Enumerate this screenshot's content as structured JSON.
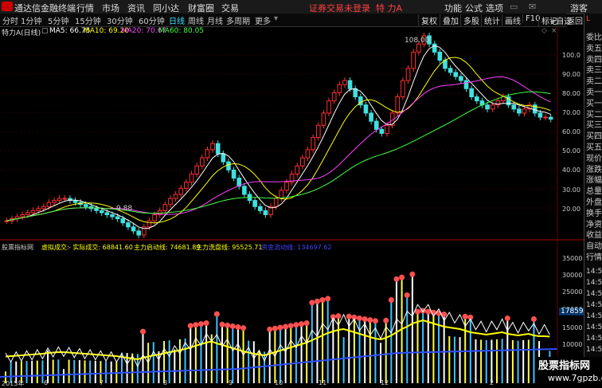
{
  "menu": {
    "app_title": "通达信金融终端",
    "items": [
      "行情",
      "市场",
      "资讯",
      "同小达",
      "财富圈",
      "交易"
    ],
    "notice": "证券交易未登录",
    "stock": "特 力A",
    "right_items": [
      "功能",
      "公式",
      "选项"
    ],
    "guest": "游客"
  },
  "toolbar": {
    "periods": [
      "分时",
      "1分钟",
      "5分钟",
      "15分钟",
      "30分钟",
      "60分钟",
      "日线",
      "周线",
      "月线",
      "多周期",
      "更多"
    ],
    "active": "日线",
    "right": [
      "复权",
      "叠加",
      "多股",
      "统计",
      "画线",
      "F10",
      "标记",
      "+自选",
      "返回"
    ]
  },
  "chart_header": {
    "title": "特力A(日线)",
    "ma5": "MA5: 66.75",
    "ma10": "MA10: 69.20",
    "ma20": "MA20: 70.67",
    "ma60": "MA60: 80.05"
  },
  "indicator_header": {
    "name": "股票指标网",
    "l1": "虚拟成交: ",
    "l2": "- 实际成交: 68841.60",
    "l3": "主力启动线: 74681.89",
    "l4": "主力洗盘线: 95525.71",
    "l5": "资金流动线: 134697.62"
  },
  "price_axis": [
    "100.0",
    "90.00",
    "80.00",
    "70.00",
    "60.00",
    "50.00",
    "40.00",
    "30.00",
    "20.00"
  ],
  "vol_axis": [
    "35000",
    "30000",
    "25000",
    "20000",
    "15000",
    "10000"
  ],
  "vol_marker": "17859",
  "annotations": {
    "high": "108.00",
    "low": "9.88"
  },
  "x_labels": [
    "2015年",
    "6",
    "7",
    "8",
    "9",
    "10",
    "11",
    "12",
    "2"
  ],
  "right_panel": [
    "委比",
    "卖五",
    "卖四",
    "卖三",
    "卖二",
    "卖一",
    "买一",
    "买二",
    "买三",
    "买四",
    "买五",
    "现价",
    "涨跌",
    "涨幅",
    "总量",
    "外盘",
    "换手",
    "净资",
    "收益",
    "自动",
    "行情"
  ],
  "right_panel_times": [
    "14:50",
    "14:50",
    "14:50",
    "14:50",
    "14:50",
    "14:50",
    "14:50",
    "14:50"
  ],
  "watermark": {
    "line1": "股票指标网",
    "line2": "www.7gpzb.com"
  },
  "colors": {
    "up": "#ff3030",
    "down": "#40e0e0",
    "ma5": "#ffffff",
    "ma10": "#ffff00",
    "ma20": "#ff40ff",
    "ma60": "#40ff40",
    "bg": "#000000"
  },
  "chart_data": {
    "type": "candlestick",
    "closes": [
      17,
      18,
      19,
      20,
      21,
      22,
      23,
      24,
      26,
      27,
      28,
      28,
      27,
      26,
      25,
      24,
      23,
      22,
      21,
      20,
      19,
      18,
      16,
      14,
      12,
      10,
      14,
      17,
      20,
      22,
      25,
      28,
      30,
      33,
      36,
      40,
      44,
      48,
      52,
      55,
      50,
      46,
      42,
      38,
      34,
      30,
      27,
      24,
      22,
      20,
      24,
      28,
      32,
      36,
      40,
      44,
      48,
      52,
      58,
      64,
      70,
      76,
      80,
      84,
      86,
      82,
      78,
      74,
      70,
      66,
      62,
      60,
      64,
      70,
      78,
      86,
      92,
      100,
      104,
      108,
      104,
      100,
      96,
      92,
      90,
      88,
      86,
      82,
      78,
      76,
      74,
      72,
      74,
      76,
      78,
      74,
      72,
      70,
      72,
      74,
      70,
      68,
      68,
      67
    ],
    "ylim": [
      10,
      108
    ]
  }
}
